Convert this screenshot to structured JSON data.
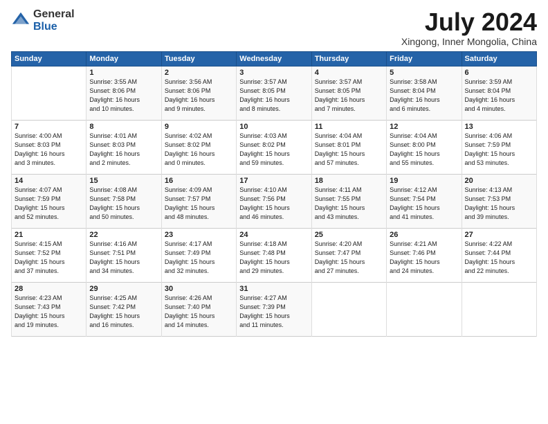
{
  "header": {
    "logo_general": "General",
    "logo_blue": "Blue",
    "month_title": "July 2024",
    "subtitle": "Xingong, Inner Mongolia, China"
  },
  "columns": [
    "Sunday",
    "Monday",
    "Tuesday",
    "Wednesday",
    "Thursday",
    "Friday",
    "Saturday"
  ],
  "weeks": [
    [
      {
        "num": "",
        "info": ""
      },
      {
        "num": "1",
        "info": "Sunrise: 3:55 AM\nSunset: 8:06 PM\nDaylight: 16 hours\nand 10 minutes."
      },
      {
        "num": "2",
        "info": "Sunrise: 3:56 AM\nSunset: 8:06 PM\nDaylight: 16 hours\nand 9 minutes."
      },
      {
        "num": "3",
        "info": "Sunrise: 3:57 AM\nSunset: 8:05 PM\nDaylight: 16 hours\nand 8 minutes."
      },
      {
        "num": "4",
        "info": "Sunrise: 3:57 AM\nSunset: 8:05 PM\nDaylight: 16 hours\nand 7 minutes."
      },
      {
        "num": "5",
        "info": "Sunrise: 3:58 AM\nSunset: 8:04 PM\nDaylight: 16 hours\nand 6 minutes."
      },
      {
        "num": "6",
        "info": "Sunrise: 3:59 AM\nSunset: 8:04 PM\nDaylight: 16 hours\nand 4 minutes."
      }
    ],
    [
      {
        "num": "7",
        "info": "Sunrise: 4:00 AM\nSunset: 8:03 PM\nDaylight: 16 hours\nand 3 minutes."
      },
      {
        "num": "8",
        "info": "Sunrise: 4:01 AM\nSunset: 8:03 PM\nDaylight: 16 hours\nand 2 minutes."
      },
      {
        "num": "9",
        "info": "Sunrise: 4:02 AM\nSunset: 8:02 PM\nDaylight: 16 hours\nand 0 minutes."
      },
      {
        "num": "10",
        "info": "Sunrise: 4:03 AM\nSunset: 8:02 PM\nDaylight: 15 hours\nand 59 minutes."
      },
      {
        "num": "11",
        "info": "Sunrise: 4:04 AM\nSunset: 8:01 PM\nDaylight: 15 hours\nand 57 minutes."
      },
      {
        "num": "12",
        "info": "Sunrise: 4:04 AM\nSunset: 8:00 PM\nDaylight: 15 hours\nand 55 minutes."
      },
      {
        "num": "13",
        "info": "Sunrise: 4:06 AM\nSunset: 7:59 PM\nDaylight: 15 hours\nand 53 minutes."
      }
    ],
    [
      {
        "num": "14",
        "info": "Sunrise: 4:07 AM\nSunset: 7:59 PM\nDaylight: 15 hours\nand 52 minutes."
      },
      {
        "num": "15",
        "info": "Sunrise: 4:08 AM\nSunset: 7:58 PM\nDaylight: 15 hours\nand 50 minutes."
      },
      {
        "num": "16",
        "info": "Sunrise: 4:09 AM\nSunset: 7:57 PM\nDaylight: 15 hours\nand 48 minutes."
      },
      {
        "num": "17",
        "info": "Sunrise: 4:10 AM\nSunset: 7:56 PM\nDaylight: 15 hours\nand 46 minutes."
      },
      {
        "num": "18",
        "info": "Sunrise: 4:11 AM\nSunset: 7:55 PM\nDaylight: 15 hours\nand 43 minutes."
      },
      {
        "num": "19",
        "info": "Sunrise: 4:12 AM\nSunset: 7:54 PM\nDaylight: 15 hours\nand 41 minutes."
      },
      {
        "num": "20",
        "info": "Sunrise: 4:13 AM\nSunset: 7:53 PM\nDaylight: 15 hours\nand 39 minutes."
      }
    ],
    [
      {
        "num": "21",
        "info": "Sunrise: 4:15 AM\nSunset: 7:52 PM\nDaylight: 15 hours\nand 37 minutes."
      },
      {
        "num": "22",
        "info": "Sunrise: 4:16 AM\nSunset: 7:51 PM\nDaylight: 15 hours\nand 34 minutes."
      },
      {
        "num": "23",
        "info": "Sunrise: 4:17 AM\nSunset: 7:49 PM\nDaylight: 15 hours\nand 32 minutes."
      },
      {
        "num": "24",
        "info": "Sunrise: 4:18 AM\nSunset: 7:48 PM\nDaylight: 15 hours\nand 29 minutes."
      },
      {
        "num": "25",
        "info": "Sunrise: 4:20 AM\nSunset: 7:47 PM\nDaylight: 15 hours\nand 27 minutes."
      },
      {
        "num": "26",
        "info": "Sunrise: 4:21 AM\nSunset: 7:46 PM\nDaylight: 15 hours\nand 24 minutes."
      },
      {
        "num": "27",
        "info": "Sunrise: 4:22 AM\nSunset: 7:44 PM\nDaylight: 15 hours\nand 22 minutes."
      }
    ],
    [
      {
        "num": "28",
        "info": "Sunrise: 4:23 AM\nSunset: 7:43 PM\nDaylight: 15 hours\nand 19 minutes."
      },
      {
        "num": "29",
        "info": "Sunrise: 4:25 AM\nSunset: 7:42 PM\nDaylight: 15 hours\nand 16 minutes."
      },
      {
        "num": "30",
        "info": "Sunrise: 4:26 AM\nSunset: 7:40 PM\nDaylight: 15 hours\nand 14 minutes."
      },
      {
        "num": "31",
        "info": "Sunrise: 4:27 AM\nSunset: 7:39 PM\nDaylight: 15 hours\nand 11 minutes."
      },
      {
        "num": "",
        "info": ""
      },
      {
        "num": "",
        "info": ""
      },
      {
        "num": "",
        "info": ""
      }
    ]
  ]
}
